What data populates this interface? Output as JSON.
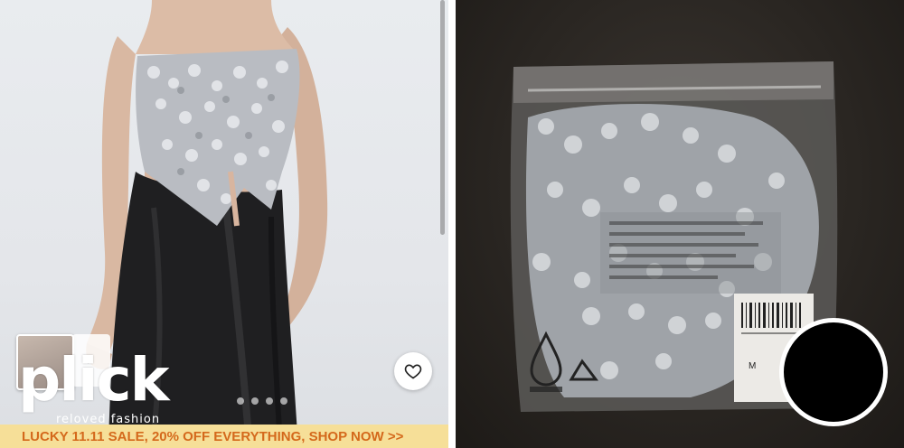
{
  "listing": {
    "logo_text": "plick",
    "logo_subtitle": "reloved fashion",
    "promo_banner": "LUCKY 11.11 SALE, 20% OFF EVERYTHING, SHOP NOW >>",
    "carousel_dots": 4,
    "bag_label": "M"
  },
  "icons": {
    "favorite": "heart-icon",
    "next_thumb": "chevron-right-icon",
    "bag_mark": "water-drop-logo-icon"
  },
  "colors": {
    "promo_bg": "#f6df98",
    "promo_text": "#d4691c",
    "logo": "#ffffff"
  }
}
